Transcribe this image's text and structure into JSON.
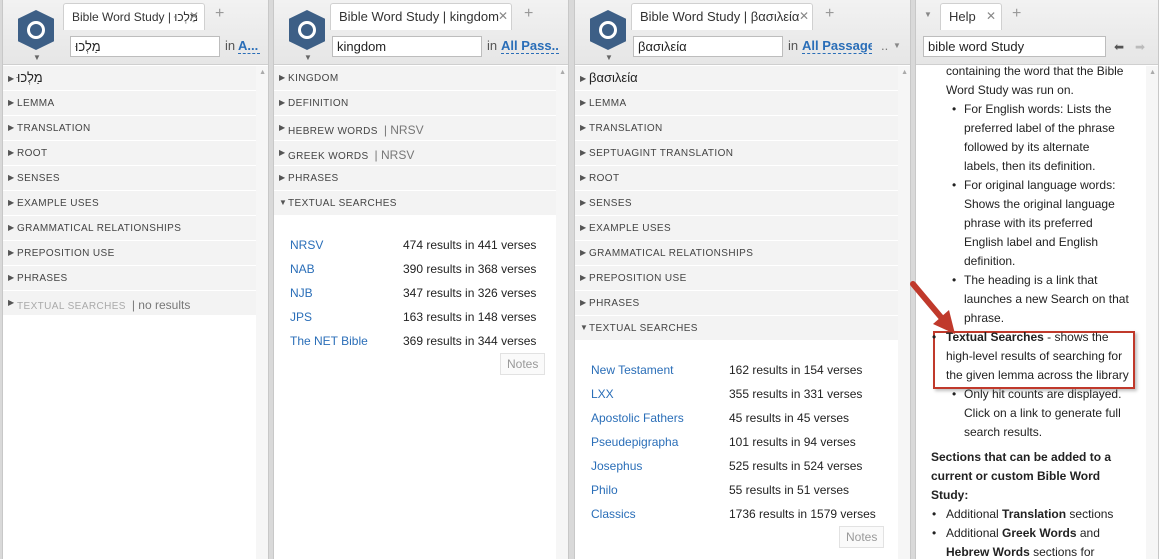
{
  "panel1": {
    "tab_title": "Bible Word Study | מַלְכוּ",
    "search_value": "מַלְכוּ",
    "in_label": "in",
    "range_label": "A...",
    "sections": [
      {
        "label": "מַלְכוּ",
        "big": true
      },
      {
        "label": "LEMMA"
      },
      {
        "label": "TRANSLATION"
      },
      {
        "label": "ROOT"
      },
      {
        "label": "SENSES"
      },
      {
        "label": "EXAMPLE USES"
      },
      {
        "label": "GRAMMATICAL RELATIONSHIPS"
      },
      {
        "label": "PREPOSITION USE"
      },
      {
        "label": "PHRASES"
      },
      {
        "label": "TEXTUAL SEARCHES",
        "extra": "| no results"
      }
    ]
  },
  "panel2": {
    "tab_title": "Bible Word Study | kingdom",
    "search_value": "kingdom",
    "in_label": "in",
    "range_label": "All Pass...",
    "sections": [
      {
        "label": "KINGDOM"
      },
      {
        "label": "DEFINITION"
      },
      {
        "label": "HEBREW WORDS",
        "extra": "|  NRSV"
      },
      {
        "label": "GREEK WORDS",
        "extra": "|  NRSV"
      },
      {
        "label": "PHRASES"
      },
      {
        "label": "TEXTUAL SEARCHES"
      }
    ],
    "results": [
      {
        "name": "NRSV",
        "count": "474 results in 441 verses"
      },
      {
        "name": "NAB",
        "count": "390 results in 368 verses"
      },
      {
        "name": "NJB",
        "count": "347 results in 326 verses"
      },
      {
        "name": "JPS",
        "count": "163 results in 148 verses"
      },
      {
        "name": "The NET Bible",
        "count": "369 results in 344 verses"
      }
    ],
    "notes_label": "Notes"
  },
  "panel3": {
    "tab_title": "Bible Word Study | βασιλεία",
    "search_value": "βασιλεία",
    "in_label": "in",
    "range_label": "All Passages",
    "more_label": "..",
    "sections": [
      {
        "label": "βασιλεία",
        "big": true
      },
      {
        "label": "LEMMA"
      },
      {
        "label": "TRANSLATION"
      },
      {
        "label": "SEPTUAGINT TRANSLATION"
      },
      {
        "label": "ROOT"
      },
      {
        "label": "SENSES"
      },
      {
        "label": "EXAMPLE USES"
      },
      {
        "label": "GRAMMATICAL RELATIONSHIPS"
      },
      {
        "label": "PREPOSITION USE"
      },
      {
        "label": "PHRASES"
      },
      {
        "label": "TEXTUAL SEARCHES"
      }
    ],
    "results": [
      {
        "name": "New Testament",
        "count": "162 results in 154 verses"
      },
      {
        "name": "LXX",
        "count": "355 results in 331 verses"
      },
      {
        "name": "Apostolic Fathers",
        "count": "45 results in 45 verses"
      },
      {
        "name": "Pseudepigrapha",
        "count": "101 results in 94 verses"
      },
      {
        "name": "Josephus",
        "count": "525 results in 524 verses"
      },
      {
        "name": "Philo",
        "count": "55 results in 51 verses"
      },
      {
        "name": "Classics",
        "count": "1736 results in 1579 verses"
      }
    ],
    "notes_label": "Notes"
  },
  "panel4": {
    "tab_title": "Help",
    "search_value": "bible word Study",
    "lines": {
      "l1": "containing the word that the Bible",
      "l2": "Word Study was run on.",
      "b1a": "For English words: Lists the",
      "b1b": "preferred label of the phrase",
      "b1c": "followed by its alternate",
      "b1d": "labels, then its definition.",
      "b2a": "For original language words:",
      "b2b": "Shows the original language",
      "b2c": "phrase with its preferred",
      "b2d": "English label and English",
      "b2e": "definition.",
      "b3a": "The heading is a link that",
      "b3b": "launches a new Search on that",
      "b3c": "phrase.",
      "ts_bold": "Textual Searches",
      "ts_rest": " - shows the",
      "ts2": "high-level results of searching for",
      "ts3": "the given lemma across the library",
      "b4a": "Only hit counts are displayed.",
      "b4b": "Click on a link to generate full",
      "b4c": "search results.",
      "h1": "Sections that can be added to a",
      "h2": "current or custom Bible Word",
      "h3": "Study:",
      "a1_pre": "Additional ",
      "a1_bold": "Translation",
      "a1_post": " sections",
      "a2_pre": "Additional ",
      "a2_bold": "Greek Words",
      "a2_post": " and",
      "a3_bold": "Hebrew Words",
      "a3_post": " sections for"
    }
  },
  "colors": {
    "link": "#2a6eb8",
    "highlight_box": "#c0392b",
    "logo": "#3d5f86"
  }
}
